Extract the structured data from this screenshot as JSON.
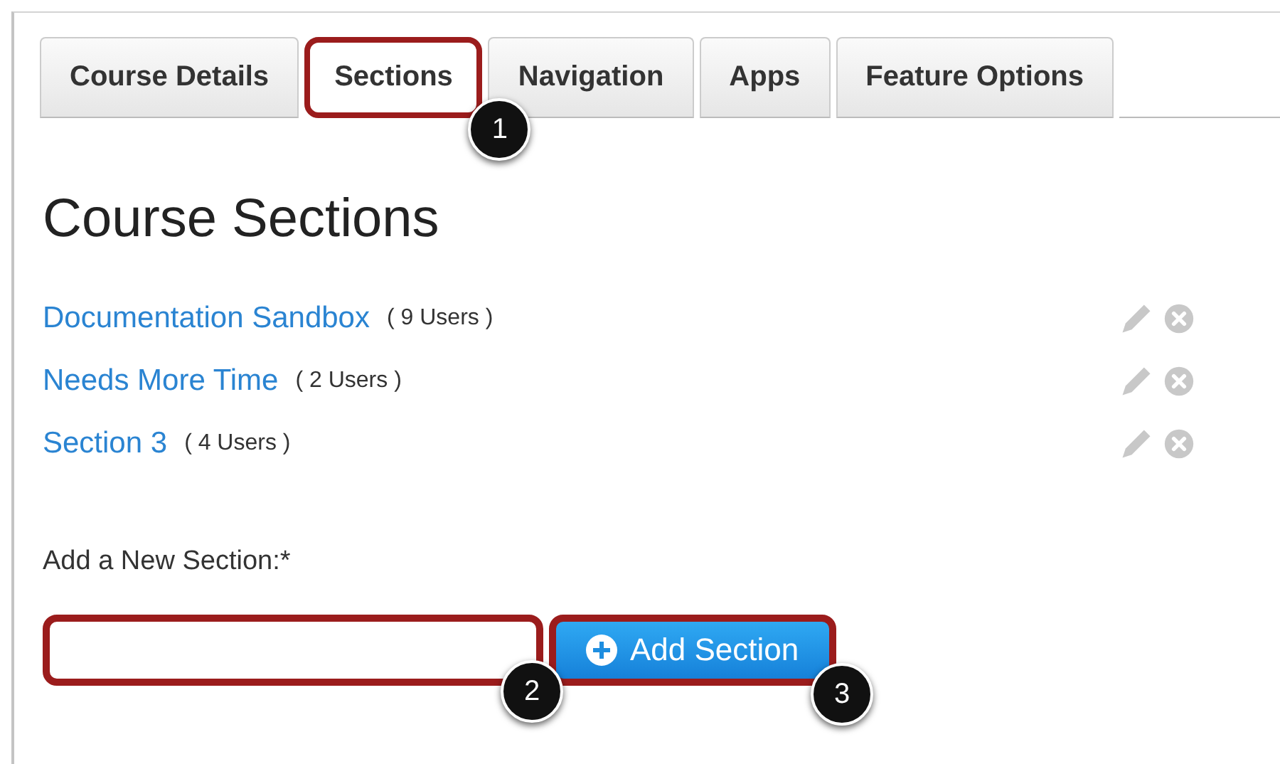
{
  "tabs": [
    {
      "label": "Course Details",
      "selected": false
    },
    {
      "label": "Sections",
      "selected": true,
      "callout": "1"
    },
    {
      "label": "Navigation",
      "selected": false
    },
    {
      "label": "Apps",
      "selected": false
    },
    {
      "label": "Feature Options",
      "selected": false
    }
  ],
  "heading": "Course Sections",
  "sections": [
    {
      "name": "Documentation Sandbox",
      "users": "( 9 Users )"
    },
    {
      "name": "Needs More Time",
      "users": "( 2 Users )"
    },
    {
      "name": "Section 3",
      "users": "( 4 Users )"
    }
  ],
  "new_section": {
    "label": "Add a New Section:*",
    "field_callout": "2",
    "button": "Add Section",
    "button_callout": "3"
  }
}
